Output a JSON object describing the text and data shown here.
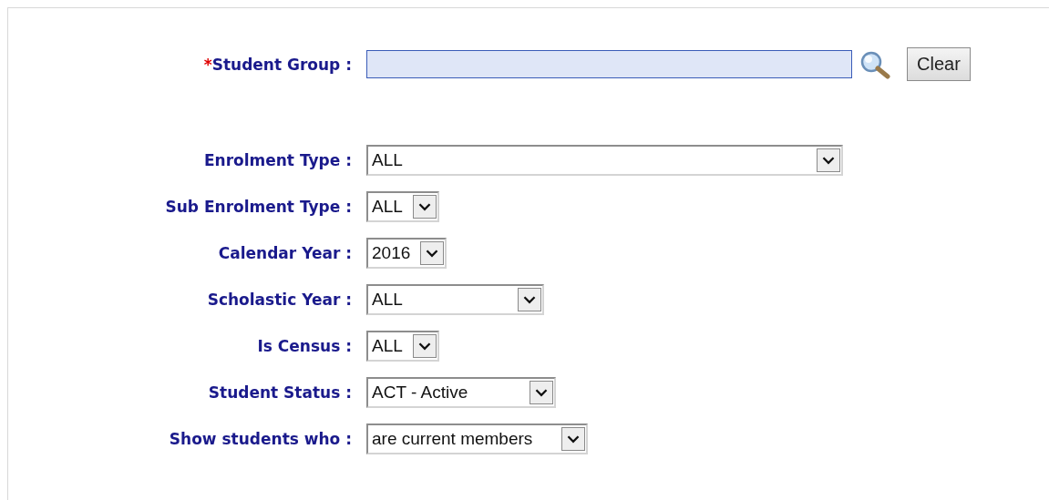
{
  "student_group": {
    "required_mark": "*",
    "label": "Student Group :",
    "clear_button": "Clear"
  },
  "filters": [
    {
      "label": "Enrolment Type :",
      "value": "ALL"
    },
    {
      "label": "Sub Enrolment Type :",
      "value": "ALL"
    },
    {
      "label": "Calendar Year :",
      "value": "2016"
    },
    {
      "label": "Scholastic Year :",
      "value": "ALL"
    },
    {
      "label": "Is Census :",
      "value": "ALL"
    },
    {
      "label": "Student Status :",
      "value": "ACT - Active"
    },
    {
      "label": "Show students who :",
      "value": "are current members"
    }
  ]
}
